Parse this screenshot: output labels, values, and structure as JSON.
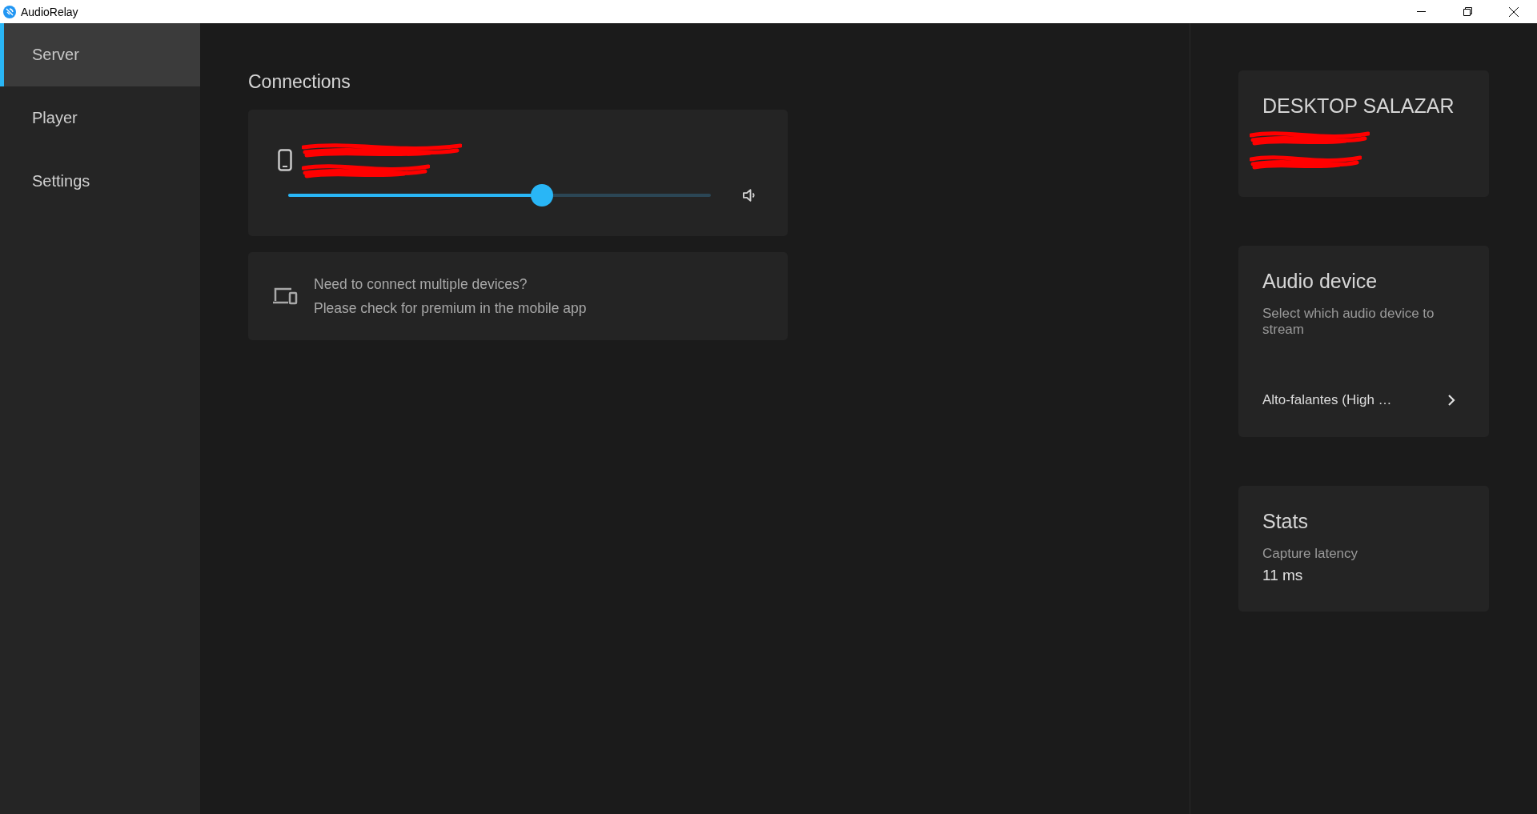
{
  "window": {
    "title": "AudioRelay"
  },
  "sidebar": {
    "items": [
      {
        "label": "Server",
        "selected": true
      },
      {
        "label": "Player",
        "selected": false
      },
      {
        "label": "Settings",
        "selected": false
      }
    ]
  },
  "connections": {
    "title": "Connections",
    "devices": [
      {
        "level": 0.6
      }
    ],
    "premium_notice": {
      "line_1": "Need to connect multiple devices?",
      "line_2": "Please check for premium in the mobile app"
    }
  },
  "server_card": {
    "title": "DESKTOP SALAZAR"
  },
  "audio_device": {
    "title": "Audio device",
    "description": "Select which audio device to stream",
    "value": "Alto-falantes (High …"
  },
  "stats": {
    "title": "Stats",
    "label": "Capture latency",
    "value": "11 ms"
  }
}
